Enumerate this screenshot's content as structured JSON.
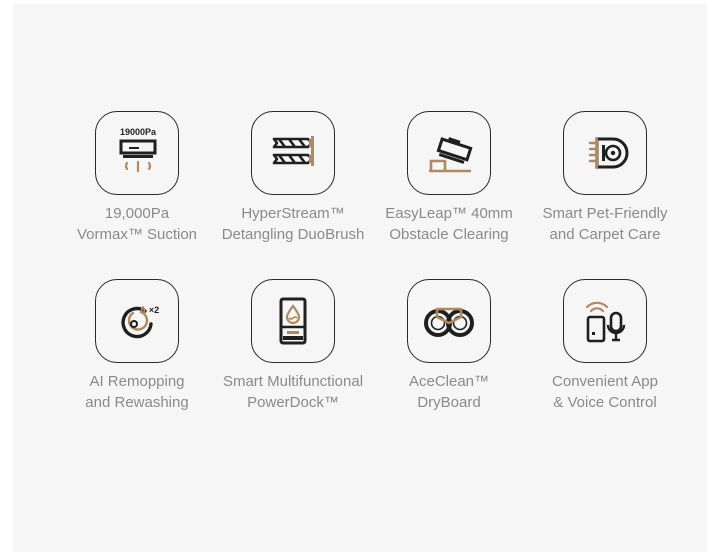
{
  "colors": {
    "background": "#f6f6f6",
    "icon_dark": "#1f1f1f",
    "icon_accent": "#b0895e",
    "label_text": "#8a8a8a"
  },
  "features": [
    {
      "icon": "suction-robot-icon",
      "badge": "19000Pa",
      "line1": "19,000Pa",
      "line2": "Vormax™ Suction"
    },
    {
      "icon": "duo-brush-icon",
      "line1": "HyperStream™",
      "line2": "Detangling DuoBrush"
    },
    {
      "icon": "obstacle-climb-icon",
      "line1": "EasyLeap™ 40mm",
      "line2": "Obstacle Clearing"
    },
    {
      "icon": "pet-hair-brush-icon",
      "line1": "Smart Pet-Friendly",
      "line2": "and Carpet Care"
    },
    {
      "icon": "remop-rewash-icon",
      "badge": "×2",
      "line1": "AI Remopping",
      "line2": "and Rewashing"
    },
    {
      "icon": "powerdock-icon",
      "line1": "Smart Multifunctional",
      "line2": "PowerDock™"
    },
    {
      "icon": "mop-pads-icon",
      "line1": "AceClean™",
      "line2": "DryBoard"
    },
    {
      "icon": "app-voice-icon",
      "line1": "Convenient App",
      "line2": "& Voice Control"
    }
  ]
}
